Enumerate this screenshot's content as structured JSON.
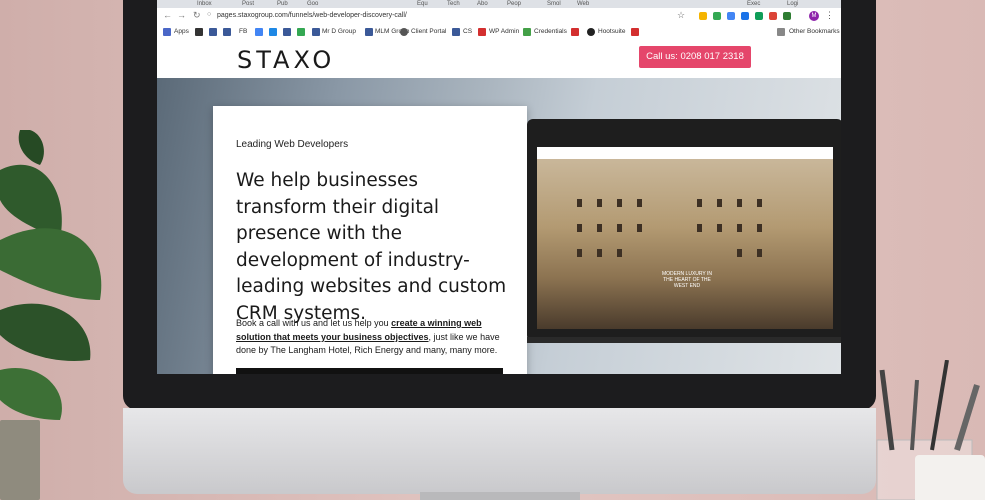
{
  "browser": {
    "tabs": [
      "Inbox",
      "Post",
      "Pub",
      "Goo",
      "Fin",
      "Equ",
      "Tech",
      "Abo",
      "Peop",
      "Smol",
      "Web",
      "",
      "",
      "",
      "",
      "",
      "Exec",
      "Logi"
    ],
    "url": "pages.staxogroup.com/funnels/web-developer-discovery-call/",
    "avatar_letter": "M"
  },
  "bookmarks": {
    "items": [
      "Apps",
      "FB",
      "Mr D Group",
      "MLM Group",
      "Client Portal",
      "CS",
      "WP Admin",
      "Credentials",
      "Hootsuite"
    ],
    "other": "Other Bookmarks"
  },
  "site": {
    "logo": "STAXO",
    "call_button": "Call us: 0208 017 2318",
    "eyebrow": "Leading Web Developers",
    "headline": "We help businesses transform their digital presence with the development of industry-leading websites and custom CRM systems.",
    "body_start": "Book a call with us and let us help you ",
    "body_link": "create a winning web solution that meets your business objectives",
    "body_end": ", just like we have done by The Langham Hotel, Rich Energy and many, many more."
  },
  "laptop": {
    "caption": "MODERN LUXURY IN THE HEART OF THE WEST END"
  },
  "colors": {
    "accent": "#e5466b",
    "text": "#1a1a1a"
  }
}
